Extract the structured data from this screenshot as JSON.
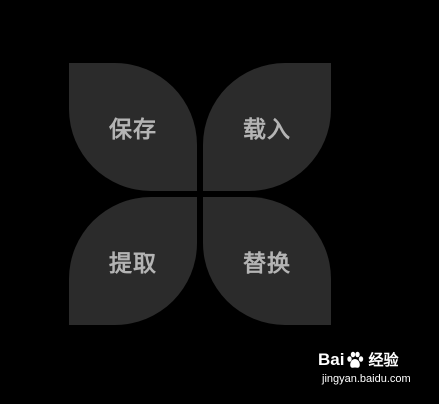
{
  "menu": {
    "items": [
      {
        "label": "保存"
      },
      {
        "label": "载入"
      },
      {
        "label": "提取"
      },
      {
        "label": "替换"
      }
    ]
  },
  "watermark": {
    "brand": "Bai",
    "brand_suffix": "经验",
    "url": "jingyan.baidu.com"
  },
  "colors": {
    "background": "#000000",
    "petal": "#2b2b2b",
    "label": "#b4b4b4"
  }
}
